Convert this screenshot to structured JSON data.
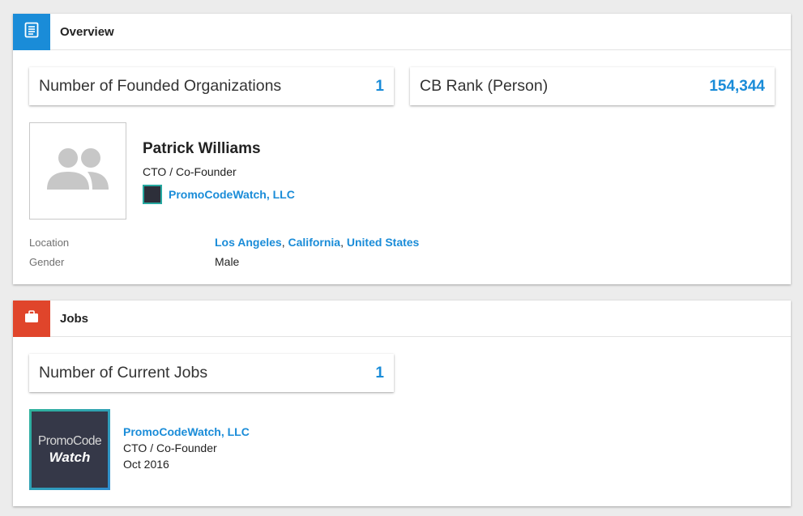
{
  "overview": {
    "title": "Overview",
    "icon": "document-icon",
    "accent": "#1a8cd8",
    "stats": [
      {
        "label": "Number of Founded Organizations",
        "value": "1"
      },
      {
        "label": "CB Rank (Person)",
        "value": "154,344"
      }
    ],
    "person": {
      "name": "Patrick Williams",
      "role": "CTO / Co-Founder",
      "organization": "PromoCodeWatch, LLC",
      "avatar_icon": "people-placeholder-icon"
    },
    "fields": {
      "location_label": "Location",
      "location_city": "Los Angeles",
      "location_region": "California",
      "location_country": "United States",
      "sep1": ", ",
      "sep2": ", ",
      "gender_label": "Gender",
      "gender_value": "Male"
    }
  },
  "jobs": {
    "title": "Jobs",
    "icon": "briefcase-icon",
    "accent": "#e0452b",
    "stat": {
      "label": "Number of Current Jobs",
      "value": "1"
    },
    "items": [
      {
        "logo_line1": "PromoCode",
        "logo_line2": "Watch",
        "organization": "PromoCodeWatch, LLC",
        "role": "CTO / Co-Founder",
        "date": "Oct 2016"
      }
    ]
  }
}
